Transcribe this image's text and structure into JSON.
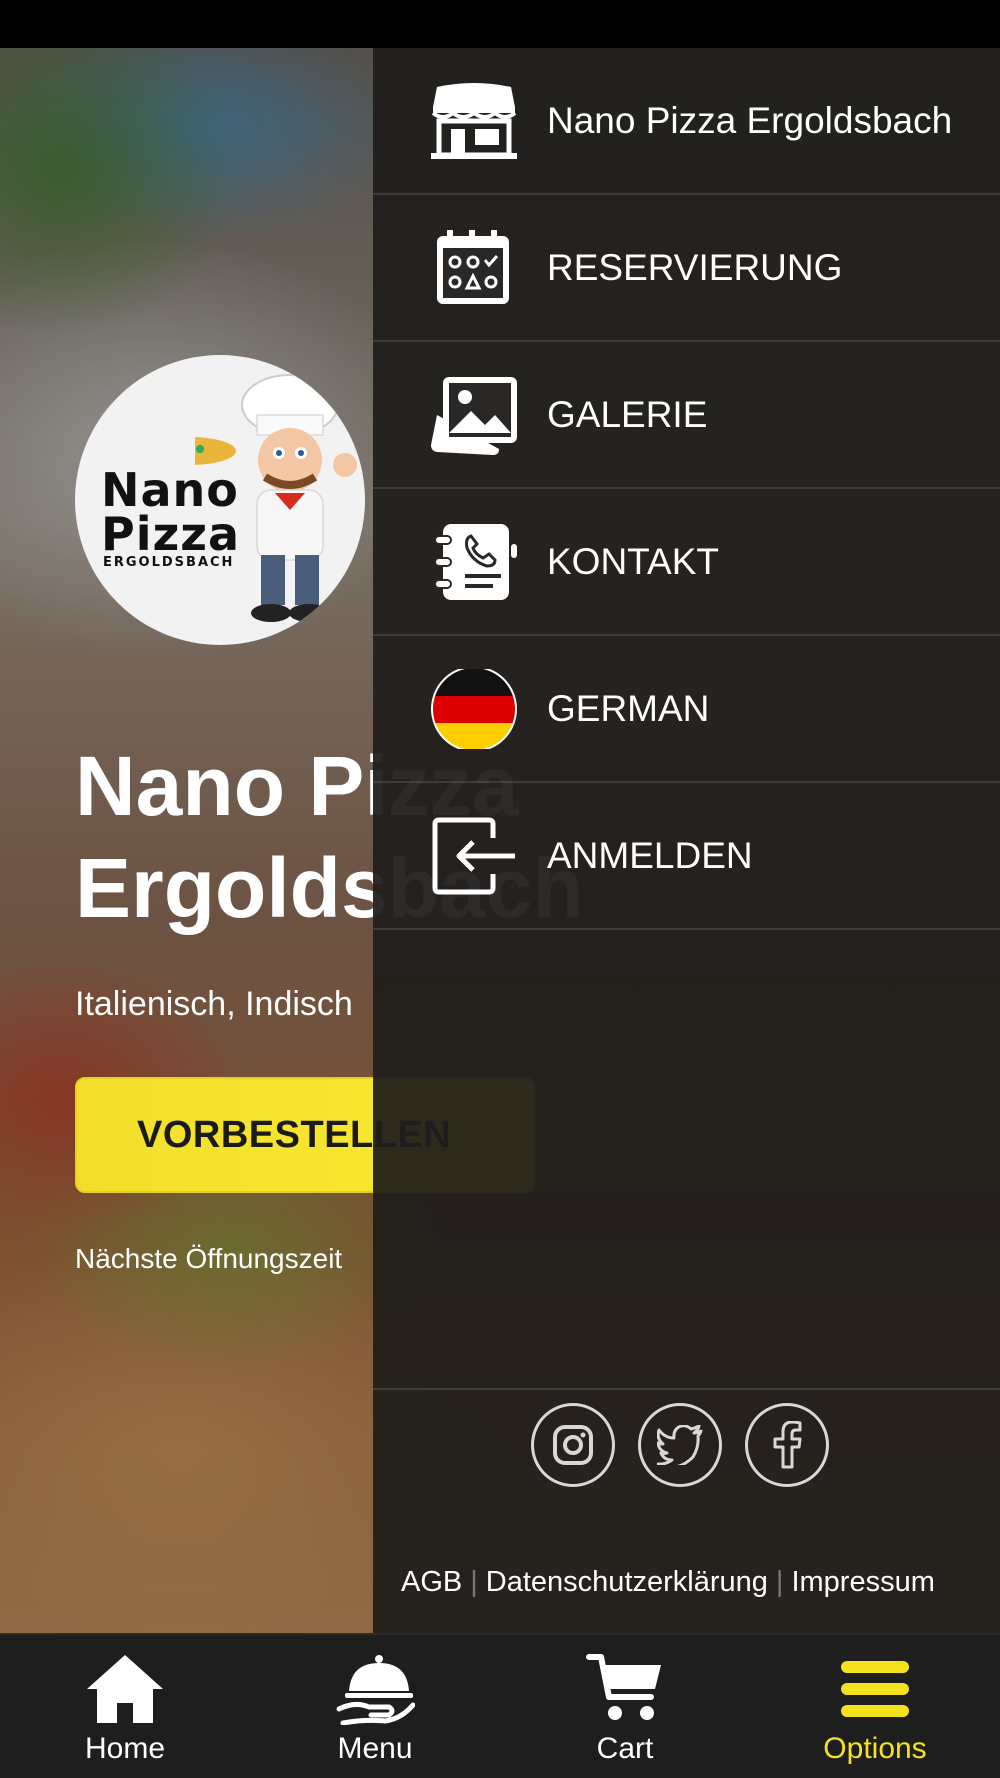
{
  "restaurant": {
    "logo_text_line1": "Nano",
    "logo_text_line2": "Pizza",
    "logo_text_line3": "ERGOLDSBACH",
    "title": "Nano Pizza Ergoldsbach",
    "cuisine": "Italienisch, Indisch",
    "order_button": "VORBESTELLEN",
    "next_open": "Nächste Öffnungszeit"
  },
  "drawer": {
    "items": [
      {
        "label": "Nano Pizza Ergoldsbach",
        "icon": "store-icon"
      },
      {
        "label": "RESERVIERUNG",
        "icon": "calendar-icon"
      },
      {
        "label": "GALERIE",
        "icon": "gallery-icon"
      },
      {
        "label": "KONTAKT",
        "icon": "contact-book-icon"
      },
      {
        "label": "GERMAN",
        "icon": "german-flag-icon"
      },
      {
        "label": "ANMELDEN",
        "icon": "login-icon"
      }
    ],
    "social": [
      "instagram-icon",
      "twitter-icon",
      "facebook-icon"
    ],
    "legal": {
      "agb": "AGB",
      "privacy": "Datenschutzerklärung",
      "imprint": "Impressum"
    }
  },
  "bottom_nav": {
    "items": [
      {
        "label": "Home",
        "icon": "home-icon"
      },
      {
        "label": "Menu",
        "icon": "cloche-icon"
      },
      {
        "label": "Cart",
        "icon": "cart-icon"
      },
      {
        "label": "Options",
        "icon": "hamburger-icon",
        "active": true
      }
    ]
  },
  "colors": {
    "accent": "#f4e21f",
    "drawer_bg": "#201e1c",
    "nav_bg": "#1e1e1e"
  }
}
